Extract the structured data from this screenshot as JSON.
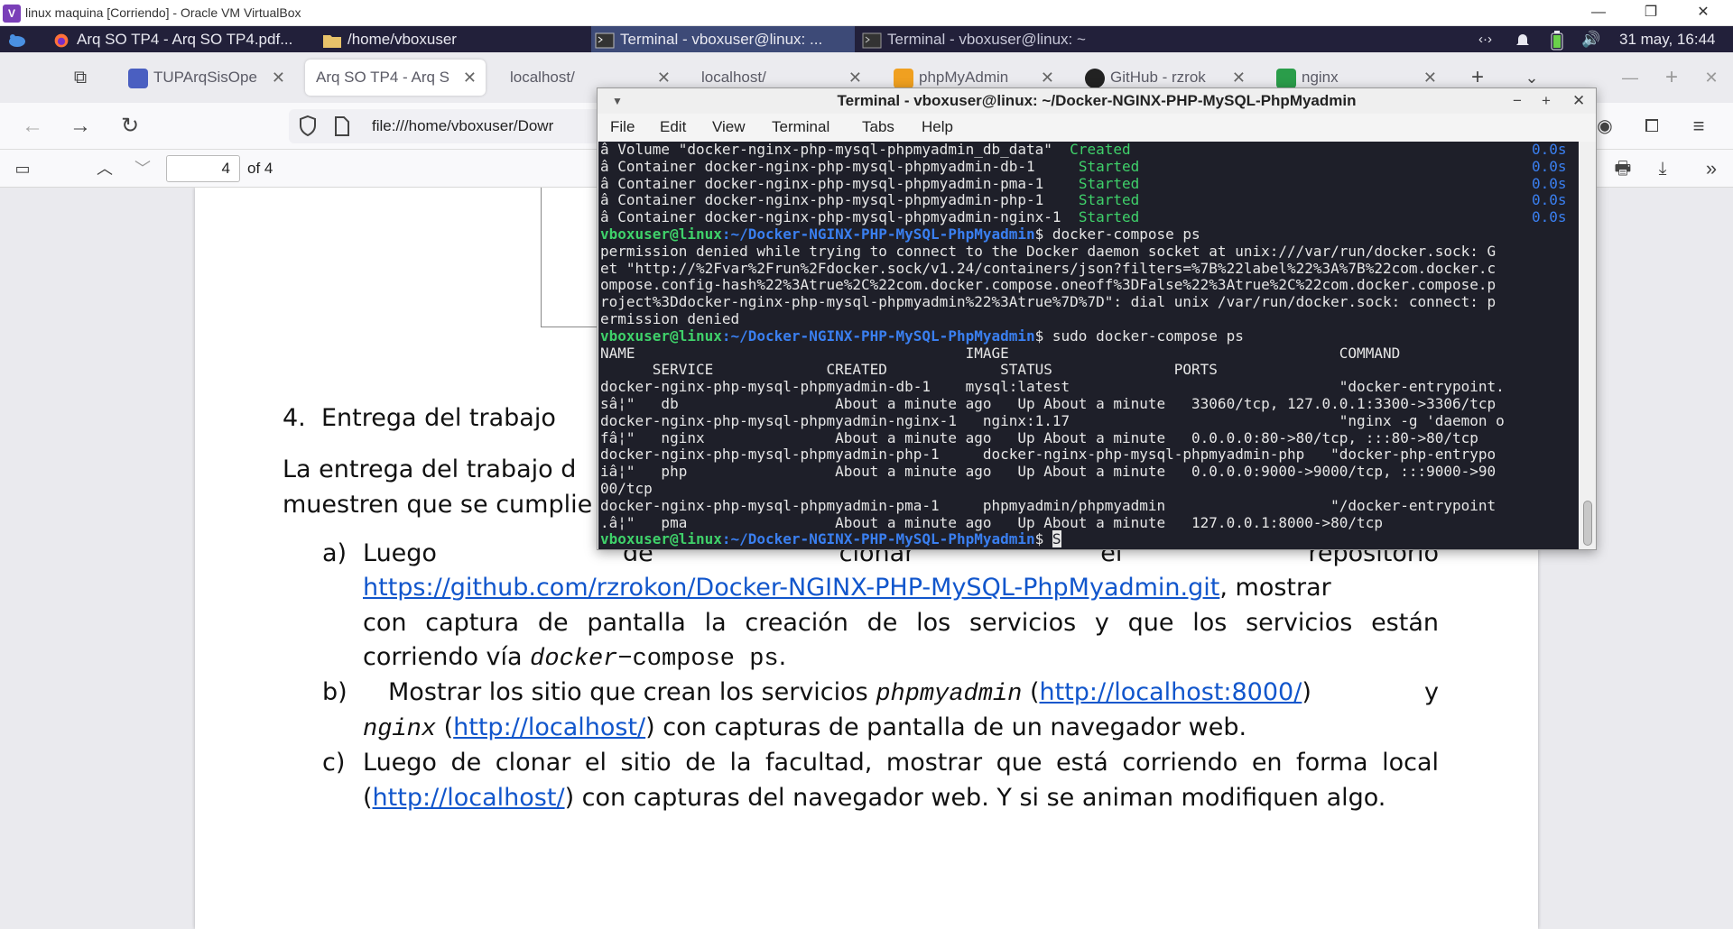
{
  "vbox": {
    "title": "linux maquina [Corriendo] - Oracle VM VirtualBox",
    "minimize": "—",
    "restore": "❐",
    "close": "✕"
  },
  "panel": {
    "items": [
      {
        "label": "Arq SO TP4 - Arq SO TP4.pdf..."
      },
      {
        "label": "/home/vboxuser"
      },
      {
        "label": "Terminal - vboxuser@linux: ..."
      },
      {
        "label": "Terminal - vboxuser@linux: ~"
      }
    ],
    "clock": "31 may, 16:44"
  },
  "browser": {
    "tabs": [
      {
        "label": "TUPArqSisOpe",
        "icon_color": "#4a5fc1"
      },
      {
        "label": "Arq SO TP4 - Arq S",
        "icon_color": ""
      },
      {
        "label": "localhost/",
        "icon_color": ""
      },
      {
        "label": "localhost/",
        "icon_color": ""
      },
      {
        "label": "phpMyAdmin",
        "icon_color": "#f0a020"
      },
      {
        "label": "GitHub - rzrok",
        "icon_color": "#222222"
      },
      {
        "label": "nginx",
        "icon_color": "#2a9d4a"
      }
    ],
    "url": "file:///home/vboxuser/Dowr"
  },
  "pdf": {
    "page_number": "4",
    "page_total": "of 4"
  },
  "document": {
    "section_number": "4.",
    "section_title": "Entrega del trabajo",
    "para_line1": "La entrega del trabajo d",
    "para_line2": "muestren que se cumplie",
    "item_a_marker": "a)",
    "item_a_text1": "Luego",
    "item_a_text2": "de",
    "item_a_text3": "clonar",
    "item_a_text4": "el",
    "item_a_text5": "repositorio",
    "item_a_link": "https://github.com/rzrokon/Docker-NGINX-PHP-MySQL-PhpMyadmin.git",
    "item_a_after_link": ",   mostrar",
    "item_a_line3": "con captura de pantalla la creación de los servicios y que los servicios están",
    "item_a_line4_pre": "corriendo vía ",
    "item_a_line4_mono": "docker",
    "item_a_line4_mono2": "−compose ps",
    "item_a_line4_post": ".",
    "item_b_marker": "b)",
    "item_b_pre": "Mostrar los sitio que crean los servicios ",
    "item_b_mono1": "phpmyadmin",
    "item_b_link1": "http://localhost:8000/",
    "item_b_y": "y",
    "item_b_mono2": "nginx",
    "item_b_link2": "http://localhost/",
    "item_b_post": ") con capturas de pantalla de un navegador web.",
    "item_c_marker": "c)",
    "item_c_line1": "Luego de clonar el sitio de la facultad, mostrar que está corriendo en forma local",
    "item_c_link": "http://localhost/",
    "item_c_post": ") con capturas del navegador web. Y si se animan modifiquen algo."
  },
  "terminal": {
    "title": "Terminal - vboxuser@linux: ~/Docker-NGINX-PHP-MySQL-PhpMyadmin",
    "menu": [
      "File",
      "Edit",
      "View",
      "Terminal",
      "Tabs",
      "Help"
    ],
    "lines": [
      {
        "pre": "â Volume \"docker-nginx-php-mysql-phpmyadmin_db_data\"  ",
        "status": "Created",
        "time": "0.0s"
      },
      {
        "pre": "â Container docker-nginx-php-mysql-phpmyadmin-db-1     ",
        "status": "Started",
        "time": "0.0s"
      },
      {
        "pre": "â Container docker-nginx-php-mysql-phpmyadmin-pma-1    ",
        "status": "Started",
        "time": "0.0s"
      },
      {
        "pre": "â Container docker-nginx-php-mysql-phpmyadmin-php-1    ",
        "status": "Started",
        "time": "0.0s"
      },
      {
        "pre": "â Container docker-nginx-php-mysql-phpmyadmin-nginx-1  ",
        "status": "Started",
        "time": "0.0s"
      }
    ],
    "prompt_user": "vboxuser@linux",
    "prompt_path": ":~/Docker-NGINX-PHP-MySQL-PhpMyadmin",
    "cmd1": "$ docker-compose ps",
    "err1": "permission denied while trying to connect to the Docker daemon socket at unix:///var/run/docker.sock: G",
    "err2": "et \"http://%2Fvar%2Frun%2Fdocker.sock/v1.24/containers/json?filters=%7B%22label%22%3A%7B%22com.docker.c",
    "err3": "ompose.config-hash%22%3Atrue%2C%22com.docker.compose.oneoff%3DFalse%22%3Atrue%2C%22com.docker.compose.p",
    "err4": "roject%3Ddocker-nginx-php-mysql-phpmyadmin%22%3Atrue%7D%7D\": dial unix /var/run/docker.sock: connect: p",
    "err5": "ermission denied",
    "cmd2": "$ sudo docker-compose ps",
    "h1": "NAME                                      IMAGE                                      COMMAND",
    "h2": "      SERVICE             CREATED             STATUS              PORTS",
    "r1a": "docker-nginx-php-mysql-phpmyadmin-db-1    mysql:latest                               \"docker-entrypoint.",
    "r1b": "sâ¦\"   db                  About a minute ago   Up About a minute   33060/tcp, 127.0.0.1:3300->3306/tcp",
    "r2a": "docker-nginx-php-mysql-phpmyadmin-nginx-1   nginx:1.17                               \"nginx -g 'daemon o",
    "r2b": "fâ¦\"   nginx               About a minute ago   Up About a minute   0.0.0.0:80->80/tcp, :::80->80/tcp",
    "r3a": "docker-nginx-php-mysql-phpmyadmin-php-1     docker-nginx-php-mysql-phpmyadmin-php   \"docker-php-entrypo",
    "r3b": "iâ¦\"   php                 About a minute ago   Up About a minute   0.0.0.0:9000->9000/tcp, :::9000->90",
    "r3c": "00/tcp",
    "r4a": "docker-nginx-php-mysql-phpmyadmin-pma-1     phpmyadmin/phpmyadmin                   \"/docker-entrypoint",
    "r4b": ".â¦\"   pma                 About a minute ago   Up About a minute   127.0.0.1:8000->80/tcp",
    "cmd3": "$ ",
    "cursor": "S"
  }
}
